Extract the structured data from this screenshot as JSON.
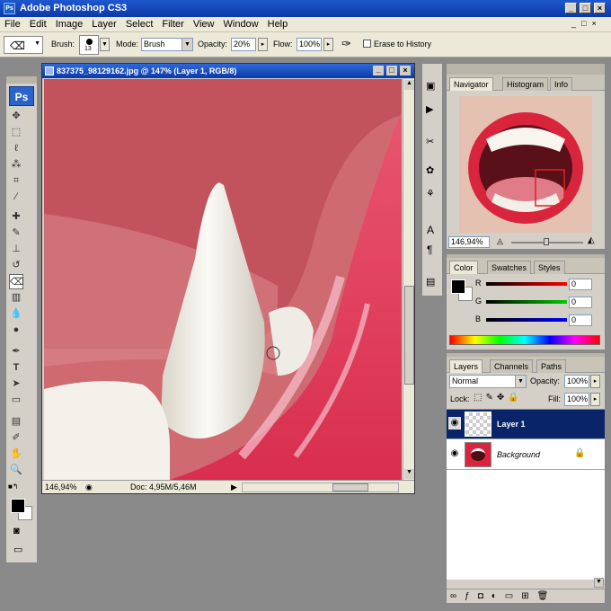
{
  "app": {
    "title": "Adobe Photoshop CS3",
    "logo": "Ps"
  },
  "menu": [
    "File",
    "Edit",
    "Image",
    "Layer",
    "Select",
    "Filter",
    "View",
    "Window",
    "Help"
  ],
  "options": {
    "brush_label": "Brush:",
    "brush_size": "13",
    "mode_label": "Mode:",
    "mode_value": "Brush",
    "opacity_label": "Opacity:",
    "opacity_value": "20%",
    "flow_label": "Flow:",
    "flow_value": "100%",
    "erase_history_label": "Erase to History"
  },
  "tools": [
    "move",
    "marquee",
    "lasso",
    "magic-wand",
    "crop",
    "slice",
    "healing",
    "brush",
    "clone-stamp",
    "history-brush",
    "eraser",
    "gradient",
    "blur",
    "dodge",
    "pen",
    "type",
    "path-select",
    "shape",
    "notes",
    "eyedropper",
    "hand",
    "zoom"
  ],
  "document": {
    "title": "837375_98129162.jpg @ 147% (Layer 1, RGB/8)",
    "zoom": "146,94%",
    "doc_size": "Doc: 4,95M/5,46M"
  },
  "navigator": {
    "tabs": [
      "Navigator",
      "Histogram",
      "Info"
    ],
    "zoom": "146,94%"
  },
  "color": {
    "tabs": [
      "Color",
      "Swatches",
      "Styles"
    ],
    "channels": [
      {
        "label": "R",
        "value": "0"
      },
      {
        "label": "G",
        "value": "0"
      },
      {
        "label": "B",
        "value": "0"
      }
    ]
  },
  "layers": {
    "tabs": [
      "Layers",
      "Channels",
      "Paths"
    ],
    "blend_mode": "Normal",
    "opacity_label": "Opacity:",
    "opacity_value": "100%",
    "lock_label": "Lock:",
    "fill_label": "Fill:",
    "fill_value": "100%",
    "items": [
      {
        "name": "Layer 1"
      },
      {
        "name": "Background"
      }
    ]
  },
  "colors": {
    "accent": "#0a246a",
    "titlebar": "#0b3aa6",
    "panel": "#d4d0c8"
  }
}
